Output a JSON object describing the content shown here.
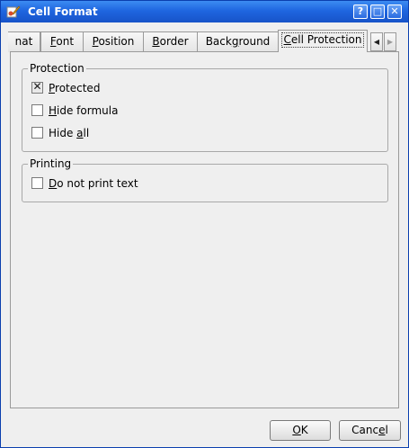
{
  "window": {
    "title": "Cell Format",
    "help_label": "?",
    "maximize_label": "□",
    "close_label": "✕",
    "icon": "app-brush-icon",
    "title_gradient": [
      "#3c8cf2",
      "#1753c8"
    ]
  },
  "tabs": [
    {
      "label": "nat",
      "mnemonic": ""
    },
    {
      "label": "Font",
      "mnemonic": "F"
    },
    {
      "label": "Position",
      "mnemonic": "P"
    },
    {
      "label": "Border",
      "mnemonic": "B"
    },
    {
      "label": "Background",
      "mnemonic": "g"
    },
    {
      "label": "Cell Protection",
      "mnemonic": "C",
      "active": true
    }
  ],
  "tab_scroll": {
    "left": "◀",
    "right": "▶"
  },
  "protection": {
    "legend": "Protection",
    "options": [
      {
        "label": "Protected",
        "checked": true
      },
      {
        "label": "Hide formula",
        "checked": false
      },
      {
        "label": "Hide all",
        "checked": false
      }
    ]
  },
  "printing": {
    "legend": "Printing",
    "options": [
      {
        "label": "Do not print text",
        "checked": false
      }
    ]
  },
  "buttons": {
    "ok": "OK",
    "cancel": "Cancel"
  },
  "check_mark": "✕"
}
